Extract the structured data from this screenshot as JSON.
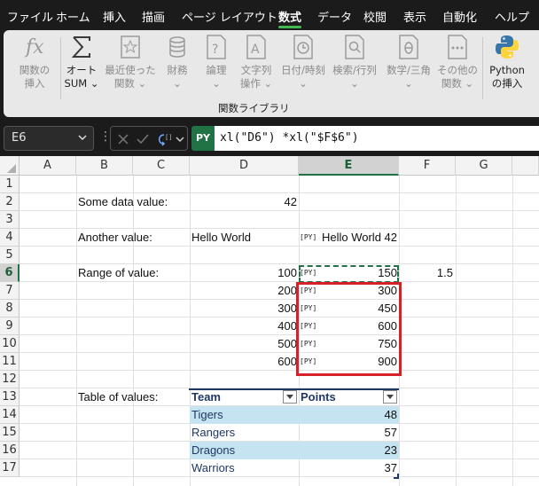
{
  "menu": {
    "items": [
      "ファイル",
      "ホーム",
      "挿入",
      "描画",
      "ページ レイアウト",
      "数式",
      "データ",
      "校閲",
      "表示",
      "自動化",
      "ヘルプ"
    ],
    "active_index": 5
  },
  "ribbon": {
    "buttons": [
      {
        "label1": "関数の",
        "label2": "挿入",
        "icon": "function-icon",
        "enabled": false
      },
      {
        "label1": "オート",
        "label2": "SUM",
        "icon": "sigma-icon",
        "enabled": true,
        "has_dropdown": true
      },
      {
        "label1": "最近使った",
        "label2": "関数",
        "icon": "star-icon",
        "enabled": false,
        "has_dropdown": true
      },
      {
        "label1": "財務",
        "label2": "",
        "icon": "database-icon",
        "enabled": false,
        "has_dropdown": true
      },
      {
        "label1": "論理",
        "label2": "",
        "icon": "question-icon",
        "enabled": false,
        "has_dropdown": true
      },
      {
        "label1": "文字列",
        "label2": "操作",
        "icon": "text-icon",
        "enabled": false,
        "has_dropdown": true
      },
      {
        "label1": "日付/時刻",
        "label2": "",
        "icon": "clock-icon",
        "enabled": false,
        "has_dropdown": true
      },
      {
        "label1": "検索/行列",
        "label2": "",
        "icon": "search-icon",
        "enabled": false,
        "has_dropdown": true
      },
      {
        "label1": "数学/三角",
        "label2": "",
        "icon": "theta-icon",
        "enabled": false,
        "has_dropdown": true
      },
      {
        "label1": "その他の",
        "label2": "関数",
        "icon": "more-icon",
        "enabled": false,
        "has_dropdown": true
      },
      {
        "label1": "Python",
        "label2": "の挿入",
        "icon": "python-icon",
        "enabled": true
      }
    ],
    "group_label": "関数ライブラリ",
    "colors": {
      "python_blue": "#3776ab",
      "python_yellow": "#ffd43b"
    }
  },
  "formula_bar": {
    "name_box": "E6",
    "py_badge": "PY",
    "formula": "xl(\"D6\") *xl(\"$F$6\")"
  },
  "grid": {
    "columns": [
      "A",
      "B",
      "C",
      "D",
      "E",
      "F",
      "G"
    ],
    "rows": [
      "1",
      "2",
      "3",
      "4",
      "5",
      "6",
      "7",
      "8",
      "9",
      "10",
      "11",
      "12",
      "13",
      "14",
      "15",
      "16",
      "17"
    ],
    "selected_column": "E",
    "selected_row": "6",
    "cells": {
      "B2": "Some data value:",
      "D2": "42",
      "B4": "Another value:",
      "D4": "Hello World",
      "E4": "Hello World 42",
      "B6": "Range of value:",
      "D6": "100",
      "E6": "150",
      "F6": "1.5",
      "D7": "200",
      "E7": "300",
      "D8": "300",
      "E8": "450",
      "D9": "400",
      "E9": "600",
      "D10": "500",
      "E10": "750",
      "D11": "600",
      "E11": "900",
      "B13": "Table of values:"
    },
    "py_icon_text": "[PY]",
    "table": {
      "headers": [
        "Team",
        "Points"
      ],
      "rows": [
        {
          "team": "Tigers",
          "points": "48"
        },
        {
          "team": "Rangers",
          "points": "57"
        },
        {
          "team": "Dragons",
          "points": "23"
        },
        {
          "team": "Warriors",
          "points": "37"
        }
      ],
      "band_color": "#c5e3f1",
      "header_color": "#1f3864"
    },
    "highlight_color": "#d6212b",
    "marquee_color": "#217346"
  }
}
